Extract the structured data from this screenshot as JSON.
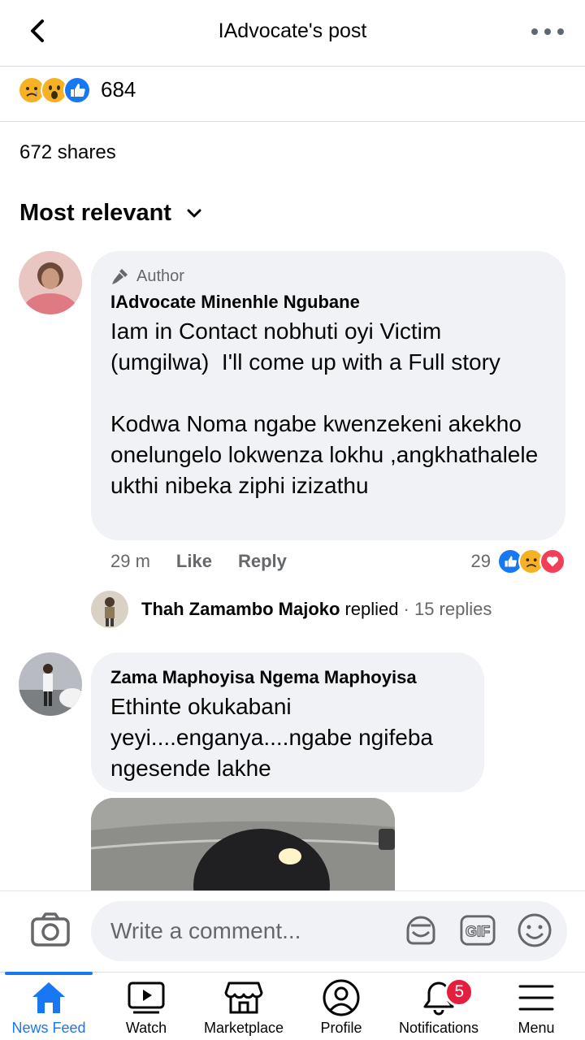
{
  "header": {
    "title": "IAdvocate's post",
    "back_icon": "chevron-left-icon",
    "more_icon": "more-horizontal-icon"
  },
  "reactions": {
    "icons": [
      "sad-icon",
      "wow-icon",
      "like-icon"
    ],
    "count": "684"
  },
  "shares": "672 shares",
  "sort": {
    "label": "Most relevant",
    "icon": "chevron-down-icon"
  },
  "comments": [
    {
      "badge": "Author",
      "name": "IAdvocate Minenhle Ngubane",
      "text": "Iam in Contact nobhuti oyi Victim (umgilwa)  I'll come up with a Full story\n\nKodwa Noma ngabe kwenzekeni akekho onelungelo lokwenza lokhu ,angkhathalele ukthi nibeka ziphi izizathu",
      "time": "29 m",
      "like_label": "Like",
      "reply_label": "Reply",
      "reaction_count": "29",
      "reaction_icons": [
        "like-icon",
        "sad-icon",
        "love-icon"
      ],
      "replies": {
        "name": "Thah Zamambo Majoko",
        "action": "replied",
        "count": "· 15 replies"
      }
    },
    {
      "name": "Zama Maphoyisa Ngema Maphoyisa",
      "text": "Ethinte okukabani yeyi....enganya....ngabe ngifeba ngesende lakhe"
    }
  ],
  "composer": {
    "placeholder": "Write a comment..."
  },
  "nav": {
    "items": [
      {
        "label": "News Feed",
        "icon": "home-icon",
        "active": true
      },
      {
        "label": "Watch",
        "icon": "video-icon"
      },
      {
        "label": "Marketplace",
        "icon": "shop-icon"
      },
      {
        "label": "Profile",
        "icon": "profile-icon"
      },
      {
        "label": "Notifications",
        "icon": "bell-icon",
        "badge": "5"
      },
      {
        "label": "Menu",
        "icon": "menu-icon"
      }
    ]
  },
  "colors": {
    "brand": "#1877f2",
    "bubble": "#f0f2f5",
    "secondary_text": "#65676b",
    "badge": "#e41e3f",
    "love": "#f33e58",
    "reaction_yellow": "#f7b125"
  }
}
